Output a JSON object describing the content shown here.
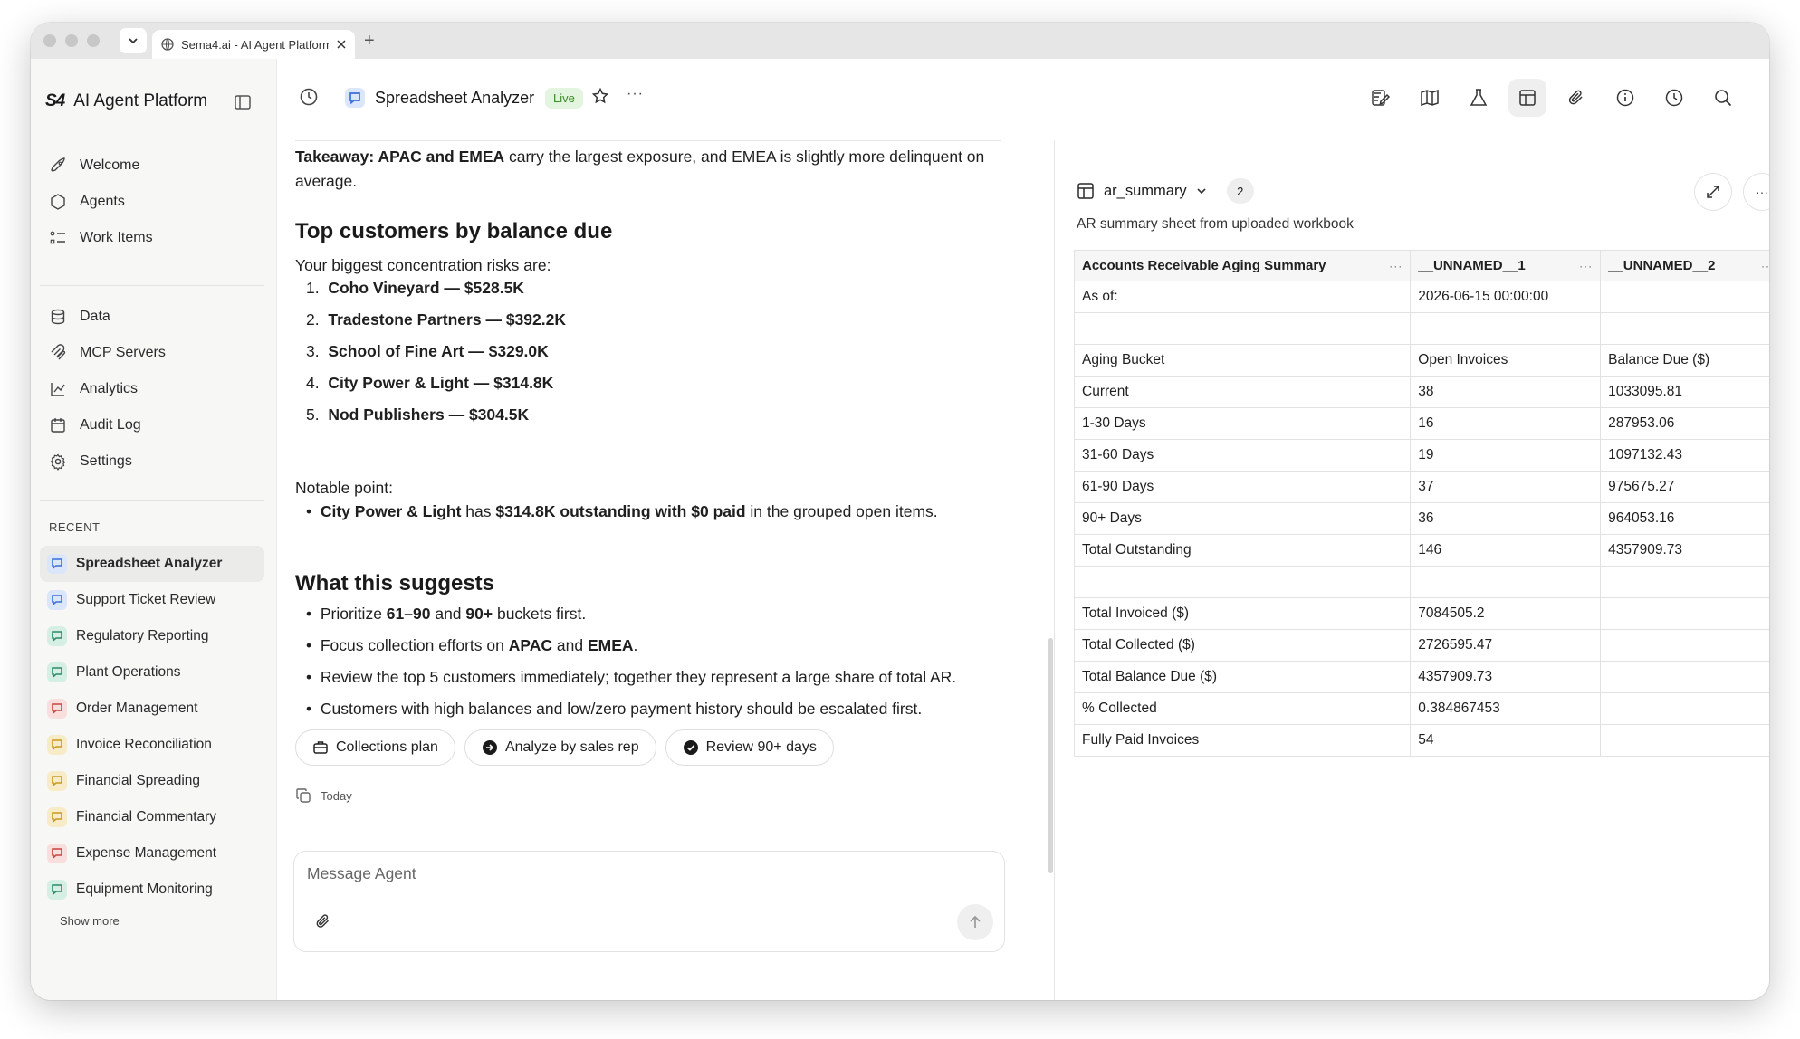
{
  "browser": {
    "tab_title": "Sema4.ai - AI Agent Platform",
    "new_tab": "+"
  },
  "sidebar": {
    "brand": "AI Agent Platform",
    "brand_logo": "S4",
    "nav_top": [
      {
        "label": "Welcome",
        "icon": "rocket-icon"
      },
      {
        "label": "Agents",
        "icon": "hexagon-icon"
      },
      {
        "label": "Work Items",
        "icon": "list-icon"
      }
    ],
    "nav_mid": [
      {
        "label": "Data",
        "icon": "database-icon"
      },
      {
        "label": "MCP Servers",
        "icon": "mcp-icon"
      },
      {
        "label": "Analytics",
        "icon": "analytics-icon"
      },
      {
        "label": "Audit Log",
        "icon": "audit-icon"
      },
      {
        "label": "Settings",
        "icon": "gear-icon"
      }
    ],
    "recent_heading": "RECENT",
    "recent": [
      {
        "label": "Spreadsheet Analyzer",
        "color": "#3b6fd8",
        "bg": "#dbe6fb",
        "active": true
      },
      {
        "label": "Support Ticket Review",
        "color": "#3b6fd8",
        "bg": "#dbe6fb"
      },
      {
        "label": "Regulatory Reporting",
        "color": "#2f8a6a",
        "bg": "#d5efe4"
      },
      {
        "label": "Plant Operations",
        "color": "#2f8a6a",
        "bg": "#d5efe4"
      },
      {
        "label": "Order Management",
        "color": "#c7463f",
        "bg": "#f8dedd"
      },
      {
        "label": "Invoice Reconciliation",
        "color": "#c79a1d",
        "bg": "#f8ecc8"
      },
      {
        "label": "Financial Spreading",
        "color": "#c79a1d",
        "bg": "#f8ecc8"
      },
      {
        "label": "Financial Commentary",
        "color": "#c79a1d",
        "bg": "#f8ecc8"
      },
      {
        "label": "Expense Management",
        "color": "#c7463f",
        "bg": "#f8dedd"
      },
      {
        "label": "Equipment Monitoring",
        "color": "#2f8a6a",
        "bg": "#d5efe4"
      }
    ],
    "show_more": "Show more"
  },
  "header": {
    "agent_name": "Spreadsheet Analyzer",
    "status": "Live",
    "more": "···"
  },
  "chat": {
    "takeaway_bold": "Takeaway: APAC and EMEA",
    "takeaway_rest": " carry the largest exposure, and EMEA is slightly more delinquent on",
    "takeaway_line2": "average.",
    "section1_title": "Top customers by balance due",
    "section1_intro": "Your biggest concentration risks are:",
    "top_customers": [
      {
        "num": "1.",
        "name": "Coho Vineyard",
        "amount": "$528.5K"
      },
      {
        "num": "2.",
        "name": "Tradestone Partners",
        "amount": "$392.2K"
      },
      {
        "num": "3.",
        "name": "School of Fine Art",
        "amount": "$329.0K"
      },
      {
        "num": "4.",
        "name": "City Power & Light",
        "amount": "$314.8K"
      },
      {
        "num": "5.",
        "name": "Nod Publishers",
        "amount": "$304.5K"
      }
    ],
    "dash": " — ",
    "notable_label": "Notable point:",
    "notable_name": "City Power & Light",
    "notable_mid": " has ",
    "notable_bold": "$314.8K outstanding with $0 paid",
    "notable_end": " in the grouped open items.",
    "section2_title": "What this suggests",
    "s1_a": "Prioritize ",
    "s1_b": "61–90",
    "s1_c": " and ",
    "s1_d": "90+",
    "s1_e": " buckets first.",
    "s2_a": "Focus collection efforts on ",
    "s2_b": "APAC",
    "s2_c": " and ",
    "s2_d": "EMEA",
    "s2_e": ".",
    "s3": "Review the top 5 customers immediately; together they represent a large share of total AR.",
    "s4": "Customers with high balances and low/zero payment history should be escalated first.",
    "chips": [
      {
        "label": "Collections plan",
        "icon": "briefcase-icon"
      },
      {
        "label": "Analyze by sales rep",
        "icon": "arrow-circle-icon"
      },
      {
        "label": "Review 90+ days",
        "icon": "check-circle-icon"
      }
    ],
    "timestamp": "Today"
  },
  "composer": {
    "placeholder": "Message Agent"
  },
  "panel": {
    "sheet_name": "ar_summary",
    "count": "2",
    "description": "AR summary sheet from uploaded workbook",
    "columns": [
      "Accounts Receivable Aging Summary",
      "__UNNAMED__1",
      "__UNNAMED__2"
    ],
    "column_menu": "···",
    "rows": [
      [
        "As of:",
        "2026-06-15 00:00:00",
        ""
      ],
      [
        "",
        "",
        ""
      ],
      [
        "Aging Bucket",
        "Open Invoices",
        "Balance Due ($)"
      ],
      [
        "Current",
        "38",
        "1033095.81"
      ],
      [
        "1-30 Days",
        "16",
        "287953.06"
      ],
      [
        "31-60 Days",
        "19",
        "1097132.43"
      ],
      [
        "61-90 Days",
        "37",
        "975675.27"
      ],
      [
        "90+ Days",
        "36",
        "964053.16"
      ],
      [
        "Total Outstanding",
        "146",
        "4357909.73"
      ],
      [
        "",
        "",
        ""
      ],
      [
        "Total Invoiced ($)",
        "7084505.2",
        ""
      ],
      [
        "Total Collected ($)",
        "2726595.47",
        ""
      ],
      [
        "Total Balance Due ($)",
        "4357909.73",
        ""
      ],
      [
        "% Collected",
        "0.384867453",
        ""
      ],
      [
        "Fully Paid Invoices",
        "54",
        ""
      ]
    ],
    "more": "···"
  }
}
